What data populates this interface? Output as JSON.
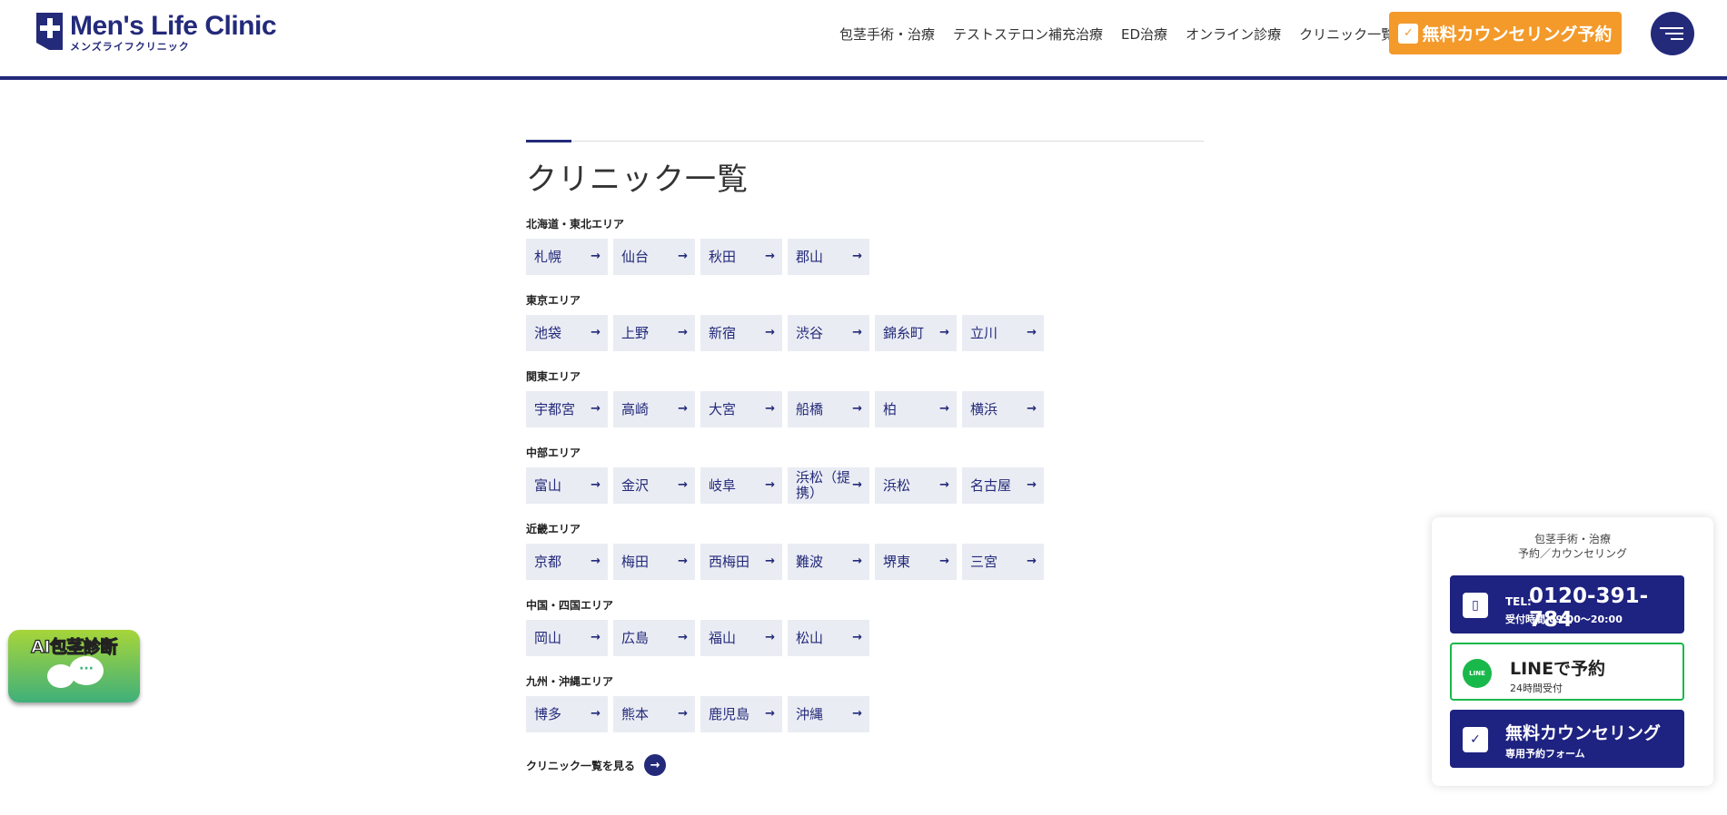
{
  "header": {
    "logo_en": "Men's Life Clinic",
    "logo_jp": "メンズライフクリニック",
    "nav": [
      "包茎手術・治療",
      "テストステロン補充治療",
      "ED治療",
      "オンライン診療",
      "クリニック一覧"
    ],
    "cta": "無料カウンセリング予約",
    "menu_icon": "hamburger-icon"
  },
  "main": {
    "title": "クリニック一覧",
    "regions": [
      {
        "label": "北海道・東北エリア",
        "clinics": [
          "札幌",
          "仙台",
          "秋田",
          "郡山"
        ]
      },
      {
        "label": "東京エリア",
        "clinics": [
          "池袋",
          "上野",
          "新宿",
          "渋谷",
          "錦糸町",
          "立川"
        ]
      },
      {
        "label": "関東エリア",
        "clinics": [
          "宇都宮",
          "高崎",
          "大宮",
          "船橋",
          "柏",
          "横浜"
        ]
      },
      {
        "label": "中部エリア",
        "clinics": [
          "富山",
          "金沢",
          "岐阜",
          "浜松（提携）",
          "浜松",
          "名古屋"
        ]
      },
      {
        "label": "近畿エリア",
        "clinics": [
          "京都",
          "梅田",
          "西梅田",
          "難波",
          "堺東",
          "三宮"
        ]
      },
      {
        "label": "中国・四国エリア",
        "clinics": [
          "岡山",
          "広島",
          "福山",
          "松山"
        ]
      },
      {
        "label": "九州・沖縄エリア",
        "clinics": [
          "博多",
          "熊本",
          "鹿児島",
          "沖縄"
        ]
      }
    ],
    "see_all": "クリニック一覧を見る",
    "arrow": "→"
  },
  "ai_badge": {
    "title": "AI包茎診断"
  },
  "widget": {
    "head_line1": "包茎手術・治療",
    "head_line2": "予約／カウンセリング",
    "tel_prefix": "TEL:",
    "tel_number": "0120-391-784",
    "tel_hours": "受付時間 09:00〜20:00",
    "line_title": "LINEで予約",
    "line_sub": "24時間受付",
    "line_icon_text": "LINE",
    "form_title": "無料カウンセリング",
    "form_sub": "専用予約フォーム"
  },
  "colors": {
    "brand": "#232a7a",
    "cta": "#f39a2b",
    "chip_bg": "#eaecf3",
    "line_green": "#19b84a"
  }
}
